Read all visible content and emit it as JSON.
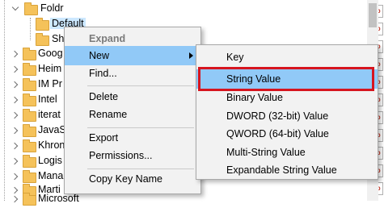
{
  "tree": {
    "items": [
      {
        "label": "Foldr",
        "chevron": "open",
        "folder": true
      },
      {
        "label": "Default",
        "selected": true,
        "folder": true
      },
      {
        "label": "Sh",
        "folder": true
      },
      {
        "label": "Goog",
        "chevron": "closed",
        "folder": true
      },
      {
        "label": "Heim",
        "chevron": "closed",
        "folder": true
      },
      {
        "label": "IM Pr",
        "chevron": "closed",
        "folder": true
      },
      {
        "label": "Intel",
        "chevron": "closed",
        "folder": true
      },
      {
        "label": "iterat",
        "chevron": "closed",
        "folder": true
      },
      {
        "label": "JavaS",
        "chevron": "closed",
        "folder": true
      },
      {
        "label": "Khron",
        "chevron": "closed",
        "folder": true
      },
      {
        "label": "Logis",
        "chevron": "closed",
        "folder": true
      },
      {
        "label": "Mana",
        "chevron": "closed",
        "folder": true
      },
      {
        "label": "Marti",
        "chevron": "closed",
        "folder": true
      },
      {
        "label": "Microsoft",
        "chevron": "closed",
        "folder": true
      }
    ]
  },
  "value_icons": {
    "label": "ab",
    "icon": "string-value-icon",
    "count": 11
  },
  "context_menu": {
    "expand": "Expand",
    "new": "New",
    "find": "Find...",
    "delete": "Delete",
    "rename": "Rename",
    "export": "Export",
    "permissions": "Permissions...",
    "copy_key_name": "Copy Key Name"
  },
  "new_submenu": {
    "key": "Key",
    "string_value": "String Value",
    "binary_value": "Binary Value",
    "dword_value": "DWORD (32-bit) Value",
    "qword_value": "QWORD (64-bit) Value",
    "multi_string_value": "Multi-String Value",
    "expandable_string_value": "Expandable String Value"
  },
  "colors": {
    "menu_highlight": "#91c9f7",
    "selection_box": "#d6151f",
    "folder": "#f5c25a"
  }
}
